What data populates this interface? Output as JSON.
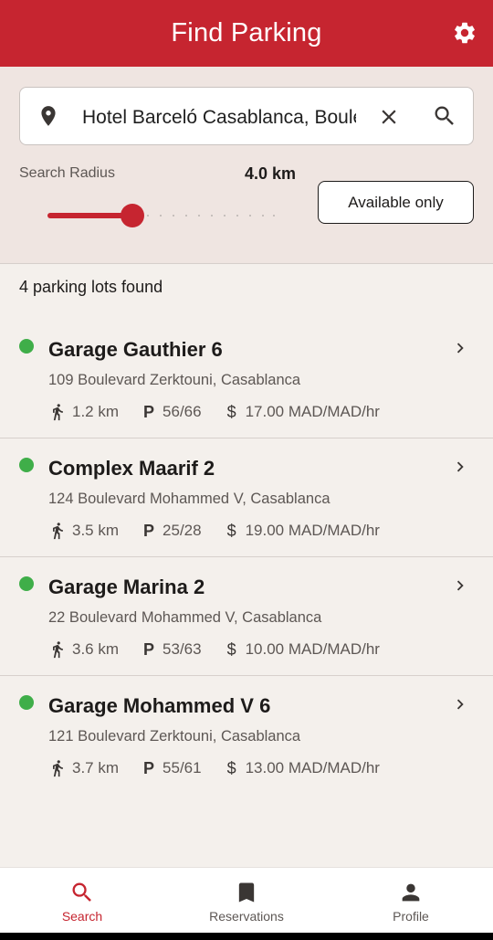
{
  "app_bar": {
    "title": "Find Parking",
    "settings_icon": "gear-icon"
  },
  "search": {
    "value": "Hotel Barceló Casablanca, Boulevard",
    "location_icon": "location-pin-icon",
    "clear_icon": "close-icon",
    "search_icon": "search-icon"
  },
  "filters": {
    "radius_label": "Search Radius",
    "radius_value": "4.0 km",
    "radius_slider_fraction": 0.37,
    "available_only_label": "Available only"
  },
  "results": {
    "count_text": "4 parking lots found",
    "lots": [
      {
        "name": "Garage Gauthier 6",
        "address": "109 Boulevard Zerktouni, Casablanca",
        "distance": "1.2 km",
        "spots": "56/66",
        "price": "17.00 MAD/MAD/hr",
        "status_color": "#3fae49"
      },
      {
        "name": "Complex Maarif 2",
        "address": "124 Boulevard Mohammed V, Casablanca",
        "distance": "3.5 km",
        "spots": "25/28",
        "price": "19.00 MAD/MAD/hr",
        "status_color": "#3fae49"
      },
      {
        "name": "Garage Marina 2",
        "address": "22 Boulevard Mohammed V, Casablanca",
        "distance": "3.6 km",
        "spots": "53/63",
        "price": "10.00 MAD/MAD/hr",
        "status_color": "#3fae49"
      },
      {
        "name": "Garage Mohammed V 6",
        "address": "121 Boulevard Zerktouni, Casablanca",
        "distance": "3.7 km",
        "spots": "55/61",
        "price": "13.00 MAD/MAD/hr",
        "status_color": "#3fae49"
      }
    ],
    "meta_icons": {
      "distance": "walking-icon",
      "spots": "P",
      "price": "$"
    }
  },
  "bottom_nav": {
    "items": [
      {
        "label": "Search",
        "icon": "search-icon",
        "active": true
      },
      {
        "label": "Reservations",
        "icon": "bookmark-icon",
        "active": false
      },
      {
        "label": "Profile",
        "icon": "person-icon",
        "active": false
      }
    ]
  },
  "colors": {
    "primary": "#c62530",
    "available": "#3fae49",
    "background": "#f4f0ec",
    "panel": "#efe5e1"
  }
}
